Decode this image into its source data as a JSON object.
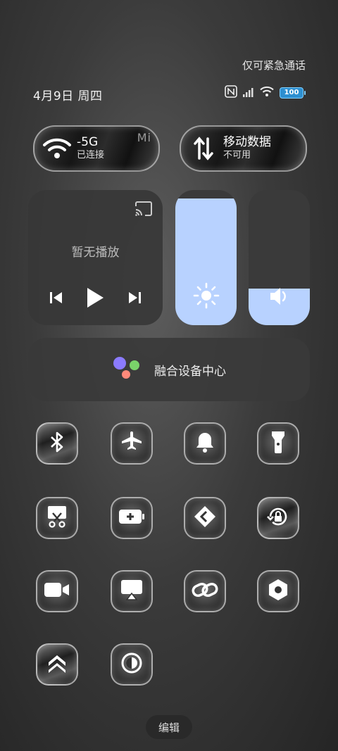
{
  "status": {
    "emergency_text": "仅可紧急通话",
    "date_text": "4月9日 周四",
    "battery_level": "100",
    "icons": [
      "nfc-icon",
      "signal-icon",
      "wifi-icon",
      "battery-icon"
    ]
  },
  "wifi_pill": {
    "name": "-5G",
    "status": "已连接",
    "deco": "Mi"
  },
  "data_pill": {
    "name": "移动数据",
    "status": "不可用"
  },
  "media": {
    "empty_text": "暂无播放",
    "icons": [
      "cast-icon",
      "previous-icon",
      "play-icon",
      "next-icon"
    ]
  },
  "brightness": {
    "level": 0.94,
    "icon": "sun-icon"
  },
  "volume": {
    "level": 0.27,
    "icon": "speaker-icon"
  },
  "device_center": {
    "label": "融合设备中心"
  },
  "tiles": [
    "bluetooth-icon",
    "airplane-icon",
    "bell-icon",
    "flashlight-icon",
    "screenshot-icon",
    "battery-saver-icon",
    "nearby-share-icon",
    "rotation-lock-icon",
    "video-icon",
    "screen-cast-icon",
    "link-icon",
    "settings-icon",
    "performance-icon",
    "dark-mode-icon"
  ],
  "colors": {
    "accent": "#b8d2ff",
    "battery": "#2d8fd0"
  },
  "edit_label": "编辑"
}
